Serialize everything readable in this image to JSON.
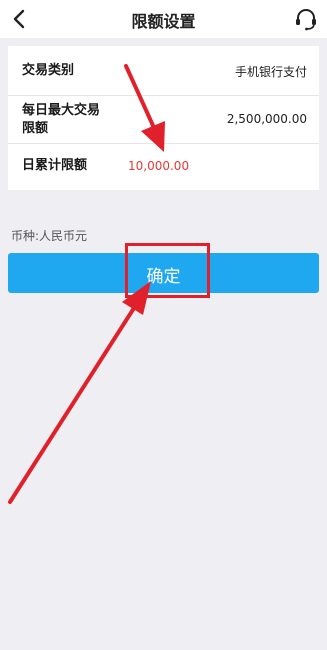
{
  "header": {
    "title": "限额设置",
    "back_icon": "chevron-left-icon",
    "support_icon": "headset-icon"
  },
  "limits": {
    "rows": [
      {
        "label": "交易类别",
        "value": "手机银行支付"
      },
      {
        "label_line1": "每日最大交易",
        "label_line2": "限额",
        "value": "2,500,000.00"
      },
      {
        "label": "日累计限额",
        "value": "10,000.00"
      }
    ]
  },
  "currency": {
    "text": "币种:人民币元"
  },
  "confirm": {
    "label": "确定"
  },
  "colors": {
    "accent": "#1fa8ef",
    "annotation": "#e0202a",
    "value_red": "#e53935",
    "background": "#eeeef3"
  }
}
